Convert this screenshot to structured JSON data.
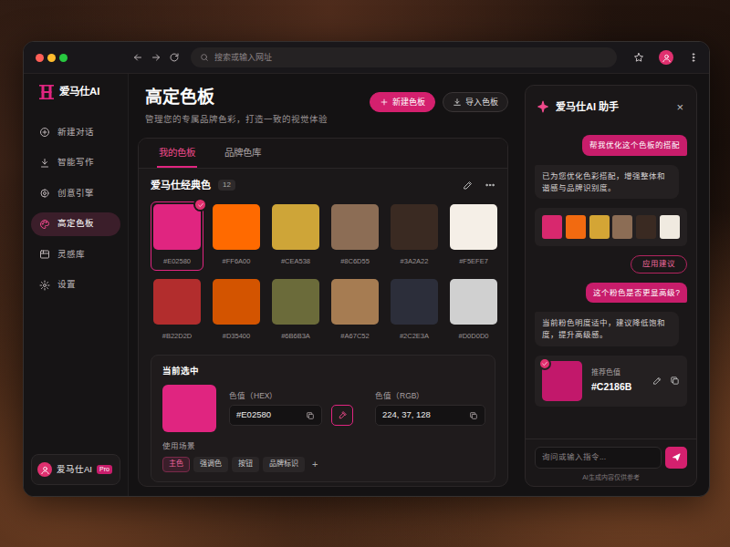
{
  "browser": {
    "address_placeholder": "搜索或输入网址"
  },
  "brand": {
    "name": "爱马仕AI"
  },
  "sidebar": {
    "items": [
      {
        "label": "新建对话",
        "selected": false
      },
      {
        "label": "智能写作",
        "selected": false
      },
      {
        "label": "创意引擎",
        "selected": false
      },
      {
        "label": "高定色板",
        "selected": true
      },
      {
        "label": "灵感库",
        "selected": false
      },
      {
        "label": "设置",
        "selected": false
      }
    ],
    "user": {
      "name": "爱马仕AI",
      "badge": "Pro"
    }
  },
  "page": {
    "title": "高定色板",
    "subtitle": "管理您的专属品牌色彩，打造一致的视觉体验",
    "actions": [
      {
        "label": "新建色板",
        "kind": "primary"
      },
      {
        "label": "导入色板",
        "kind": "secondary"
      }
    ]
  },
  "tabs": [
    {
      "label": "我的色板",
      "selected": true
    },
    {
      "label": "品牌色库",
      "selected": false
    }
  ],
  "palette": {
    "name": "爱马仕经典色",
    "count": "12",
    "swatches": [
      {
        "hex": "#E02580",
        "color": "#E02580",
        "selected": true
      },
      {
        "hex": "#FF6A00",
        "color": "#FF6A00",
        "selected": false
      },
      {
        "hex": "#CEA538",
        "color": "#CEA538",
        "selected": false
      },
      {
        "hex": "#8C6D55",
        "color": "#8C6D55",
        "selected": false
      },
      {
        "hex": "#3A2A22",
        "color": "#3A2A22",
        "selected": false
      },
      {
        "hex": "#F5EFE7",
        "color": "#F5EFE7",
        "selected": false
      },
      {
        "hex": "#B22D2D",
        "color": "#B22D2D",
        "selected": false
      },
      {
        "hex": "#D35400",
        "color": "#D35400",
        "selected": false
      },
      {
        "hex": "#6B6B3A",
        "color": "#6B6B3A",
        "selected": false
      },
      {
        "hex": "#A67C52",
        "color": "#A67C52",
        "selected": false
      },
      {
        "hex": "#2C2E3A",
        "color": "#2C2E3A",
        "selected": false
      },
      {
        "hex": "#D0D0D0",
        "color": "#D0D0D0",
        "selected": false
      }
    ]
  },
  "current": {
    "heading": "当前选中",
    "color": "#E02580",
    "hex_label": "色值（HEX）",
    "hex": "#E02580",
    "rgb_label": "色值（RGB）",
    "rgb": "224, 37, 128",
    "usage_label": "使用场景",
    "tags": [
      {
        "label": "主色",
        "selected": true
      },
      {
        "label": "强调色",
        "selected": false
      },
      {
        "label": "按钮",
        "selected": false
      },
      {
        "label": "品牌标识",
        "selected": false
      }
    ],
    "add": "+"
  },
  "assistant": {
    "title": "爱马仕AI 助手",
    "close": "×",
    "messages": [
      {
        "kind": "user",
        "text": "帮我优化这个色板的搭配"
      },
      {
        "kind": "bot",
        "text": "已为您优化色彩搭配，增强整体和谐感与品牌识别度。"
      },
      {
        "kind": "palette",
        "colors": [
          "#D8286E",
          "#F26A10",
          "#D4A535",
          "#8C6D55",
          "#3A2A22",
          "#F0EAE0"
        ],
        "action": "应用建议"
      },
      {
        "kind": "user",
        "text": "这个粉色是否更显高级?"
      },
      {
        "kind": "bot",
        "text": "当前粉色明度适中，建议降低饱和度，提升高级感。"
      },
      {
        "kind": "recommendation",
        "label": "推荐色值",
        "hex": "#C2186B",
        "color": "#C2186B",
        "selected": true
      }
    ],
    "input_placeholder": "询问或输入指令...",
    "footer": "AI生成内容仅供参考"
  }
}
